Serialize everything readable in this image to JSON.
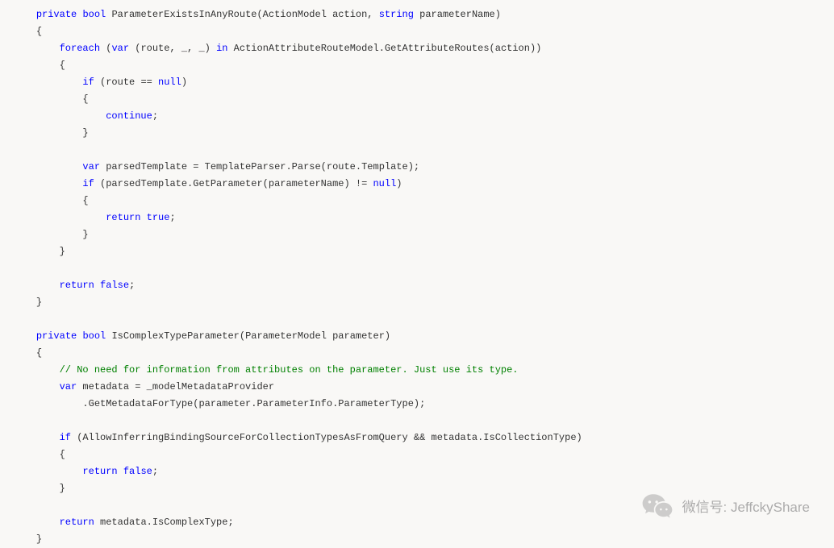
{
  "code": {
    "lines": [
      {
        "indent": 1,
        "tokens": [
          {
            "t": "kw",
            "v": "private"
          },
          {
            "t": "plain",
            "v": " "
          },
          {
            "t": "kw",
            "v": "bool"
          },
          {
            "t": "plain",
            "v": " ParameterExistsInAnyRoute(ActionModel action, "
          },
          {
            "t": "kw",
            "v": "string"
          },
          {
            "t": "plain",
            "v": " parameterName)"
          }
        ]
      },
      {
        "indent": 1,
        "tokens": [
          {
            "t": "plain",
            "v": "{"
          }
        ]
      },
      {
        "indent": 2,
        "tokens": [
          {
            "t": "kw",
            "v": "foreach"
          },
          {
            "t": "plain",
            "v": " ("
          },
          {
            "t": "kw",
            "v": "var"
          },
          {
            "t": "plain",
            "v": " (route, _, _) "
          },
          {
            "t": "kw",
            "v": "in"
          },
          {
            "t": "plain",
            "v": " ActionAttributeRouteModel.GetAttributeRoutes(action))"
          }
        ]
      },
      {
        "indent": 2,
        "tokens": [
          {
            "t": "plain",
            "v": "{"
          }
        ]
      },
      {
        "indent": 3,
        "tokens": [
          {
            "t": "kw",
            "v": "if"
          },
          {
            "t": "plain",
            "v": " (route == "
          },
          {
            "t": "kw",
            "v": "null"
          },
          {
            "t": "plain",
            "v": ")"
          }
        ]
      },
      {
        "indent": 3,
        "tokens": [
          {
            "t": "plain",
            "v": "{"
          }
        ]
      },
      {
        "indent": 4,
        "tokens": [
          {
            "t": "kw",
            "v": "continue"
          },
          {
            "t": "plain",
            "v": ";"
          }
        ]
      },
      {
        "indent": 3,
        "tokens": [
          {
            "t": "plain",
            "v": "}"
          }
        ]
      },
      {
        "indent": 0,
        "tokens": []
      },
      {
        "indent": 3,
        "tokens": [
          {
            "t": "kw",
            "v": "var"
          },
          {
            "t": "plain",
            "v": " parsedTemplate = TemplateParser.Parse(route.Template);"
          }
        ]
      },
      {
        "indent": 3,
        "tokens": [
          {
            "t": "kw",
            "v": "if"
          },
          {
            "t": "plain",
            "v": " (parsedTemplate.GetParameter(parameterName) != "
          },
          {
            "t": "kw",
            "v": "null"
          },
          {
            "t": "plain",
            "v": ")"
          }
        ]
      },
      {
        "indent": 3,
        "tokens": [
          {
            "t": "plain",
            "v": "{"
          }
        ]
      },
      {
        "indent": 4,
        "tokens": [
          {
            "t": "kw",
            "v": "return"
          },
          {
            "t": "plain",
            "v": " "
          },
          {
            "t": "kw",
            "v": "true"
          },
          {
            "t": "plain",
            "v": ";"
          }
        ]
      },
      {
        "indent": 3,
        "tokens": [
          {
            "t": "plain",
            "v": "}"
          }
        ]
      },
      {
        "indent": 2,
        "tokens": [
          {
            "t": "plain",
            "v": "}"
          }
        ]
      },
      {
        "indent": 0,
        "tokens": []
      },
      {
        "indent": 2,
        "tokens": [
          {
            "t": "kw",
            "v": "return"
          },
          {
            "t": "plain",
            "v": " "
          },
          {
            "t": "kw",
            "v": "false"
          },
          {
            "t": "plain",
            "v": ";"
          }
        ]
      },
      {
        "indent": 1,
        "tokens": [
          {
            "t": "plain",
            "v": "}"
          }
        ]
      },
      {
        "indent": 0,
        "tokens": []
      },
      {
        "indent": 1,
        "tokens": [
          {
            "t": "kw",
            "v": "private"
          },
          {
            "t": "plain",
            "v": " "
          },
          {
            "t": "kw",
            "v": "bool"
          },
          {
            "t": "plain",
            "v": " IsComplexTypeParameter(ParameterModel parameter)"
          }
        ]
      },
      {
        "indent": 1,
        "tokens": [
          {
            "t": "plain",
            "v": "{"
          }
        ]
      },
      {
        "indent": 2,
        "tokens": [
          {
            "t": "com",
            "v": "// No need for information from attributes on the parameter. Just use its type."
          }
        ]
      },
      {
        "indent": 2,
        "tokens": [
          {
            "t": "kw",
            "v": "var"
          },
          {
            "t": "plain",
            "v": " metadata = _modelMetadataProvider"
          }
        ]
      },
      {
        "indent": 3,
        "tokens": [
          {
            "t": "plain",
            "v": ".GetMetadataForType(parameter.ParameterInfo.ParameterType);"
          }
        ]
      },
      {
        "indent": 0,
        "tokens": []
      },
      {
        "indent": 2,
        "tokens": [
          {
            "t": "kw",
            "v": "if"
          },
          {
            "t": "plain",
            "v": " (AllowInferringBindingSourceForCollectionTypesAsFromQuery && metadata.IsCollectionType)"
          }
        ]
      },
      {
        "indent": 2,
        "tokens": [
          {
            "t": "plain",
            "v": "{"
          }
        ]
      },
      {
        "indent": 3,
        "tokens": [
          {
            "t": "kw",
            "v": "return"
          },
          {
            "t": "plain",
            "v": " "
          },
          {
            "t": "kw",
            "v": "false"
          },
          {
            "t": "plain",
            "v": ";"
          }
        ]
      },
      {
        "indent": 2,
        "tokens": [
          {
            "t": "plain",
            "v": "}"
          }
        ]
      },
      {
        "indent": 0,
        "tokens": []
      },
      {
        "indent": 2,
        "tokens": [
          {
            "t": "kw",
            "v": "return"
          },
          {
            "t": "plain",
            "v": " metadata.IsComplexType;"
          }
        ]
      },
      {
        "indent": 1,
        "tokens": [
          {
            "t": "plain",
            "v": "}"
          }
        ]
      }
    ]
  },
  "watermark": {
    "label": "微信号:",
    "value": "JeffckyShare"
  }
}
